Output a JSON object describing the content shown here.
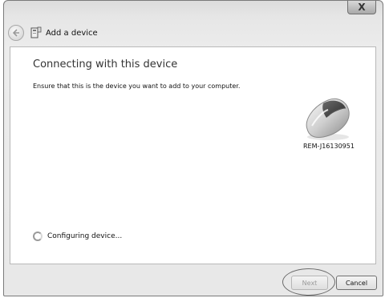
{
  "window": {
    "close_glyph": "X"
  },
  "header": {
    "title": "Add a device",
    "back_icon": "back-arrow-icon",
    "title_icon": "device-icon"
  },
  "main": {
    "heading": "Connecting with this device",
    "instruction": "Ensure that this is the device you want to add to your computer.",
    "device": {
      "name": "REM-J16130951",
      "icon": "mouse-icon"
    },
    "status": {
      "text": "Configuring device...",
      "icon": "spinner-icon"
    }
  },
  "footer": {
    "next_label": "Next",
    "cancel_label": "Cancel"
  },
  "colors": {
    "frame": "#e8e8e8",
    "content_bg": "#ffffff",
    "disabled_text": "#9a9a9a"
  }
}
